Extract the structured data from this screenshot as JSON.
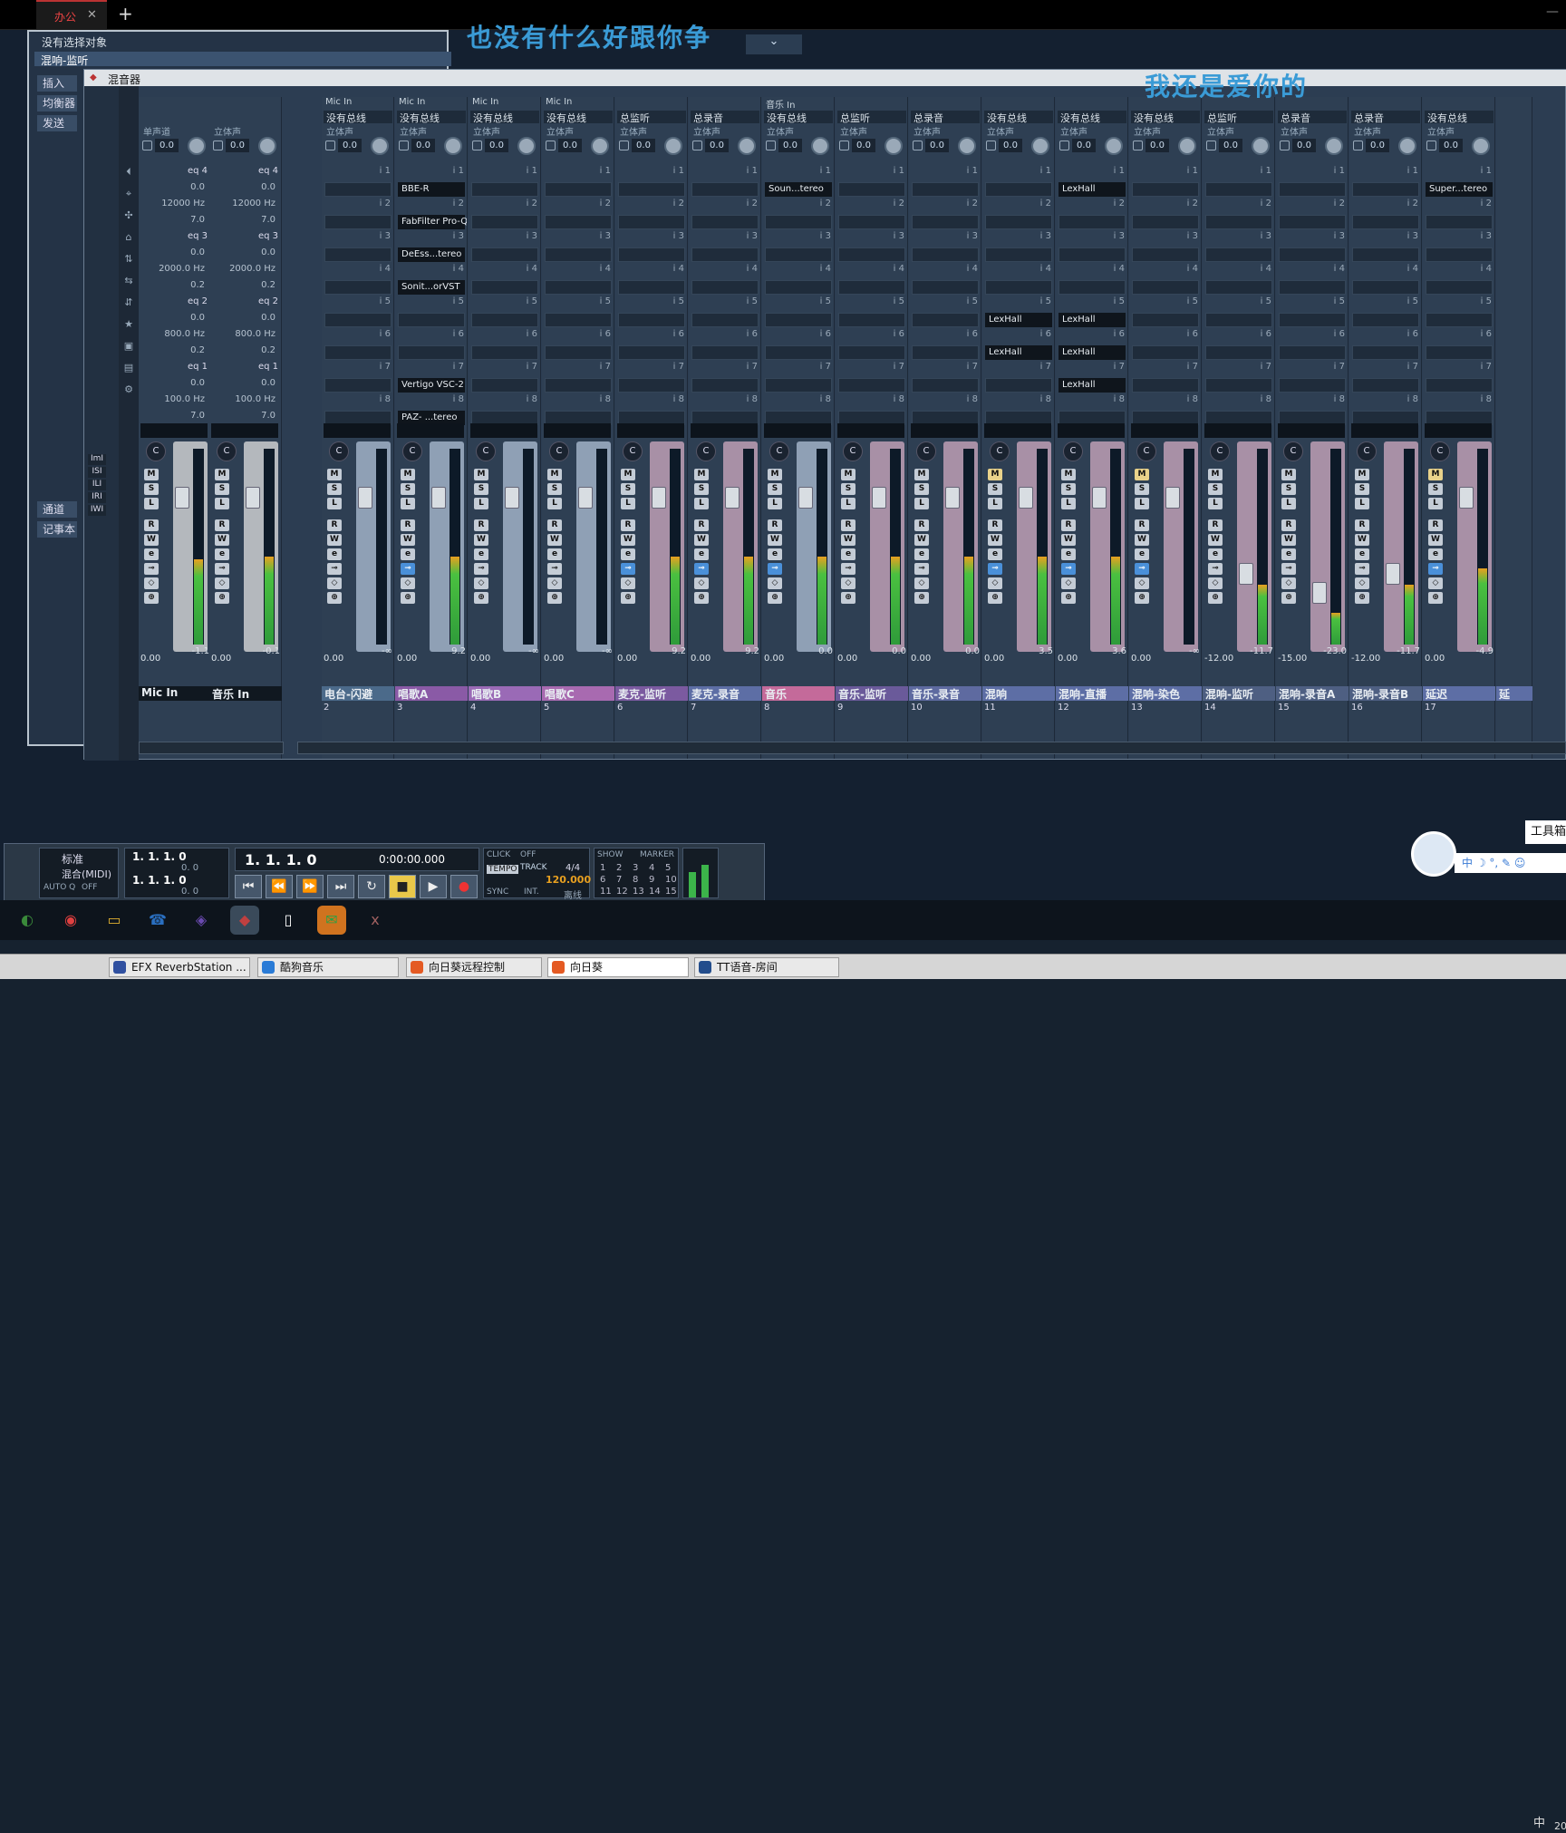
{
  "browser_tab": {
    "label": "办公",
    "close": "✕",
    "new": "+",
    "minimize": "—"
  },
  "inspector": {
    "no_selection": "没有选择对象",
    "channel": "混响-监听",
    "side_tabs": [
      "插入",
      "均衡器",
      "发送"
    ],
    "side_tabs_lower": [
      "通道",
      "记事本"
    ]
  },
  "lyrics": {
    "line1": "也没有什么好跟你争",
    "line2": "我还是爱你的",
    "dropdown": "⌄"
  },
  "mixer": {
    "title": "混音器",
    "left_input_strips": [
      {
        "name": "Mic In",
        "type": "单声道",
        "gain": "0.0",
        "vol": "0.00",
        "peak": "-1.1"
      },
      {
        "name": "音乐 In",
        "type": "立体声",
        "gain": "0.0",
        "vol": "0.00",
        "peak": "-0.1"
      }
    ],
    "eq_labels": [
      "eq 4",
      "eq 3",
      "eq 2",
      "eq 1"
    ],
    "eq_values": {
      "eq4": [
        "0.0",
        "12000 Hz",
        "7.0"
      ],
      "eq3": [
        "0.0",
        "2000.0 Hz",
        "0.2"
      ],
      "eq2": [
        "0.0",
        "800.0 Hz",
        "0.2"
      ],
      "eq1": [
        "0.0",
        "100.0 Hz",
        "7.0"
      ]
    },
    "channels": [
      {
        "num": "2",
        "name": "电台-闪避",
        "input": "Mic In",
        "output": "没有总线",
        "type": "立体声",
        "gain": "0.0",
        "vol": "0.00",
        "peak": "-∞",
        "color": "#4b6a8a",
        "plugins": []
      },
      {
        "num": "3",
        "name": "唱歌A",
        "input": "Mic In",
        "output": "没有总线",
        "type": "立体声",
        "gain": "0.0",
        "vol": "0.00",
        "peak": "9.2",
        "color": "#8a5aa6",
        "plugins": [
          {
            "slot": 0,
            "name": "BBE-R"
          },
          {
            "slot": 1,
            "name": "FabFilter Pro-Q"
          },
          {
            "slot": 2,
            "name": "DeEss...tereo"
          },
          {
            "slot": 3,
            "name": "Sonit...orVST"
          },
          {
            "slot": 6,
            "name": "Vertigo VSC-2"
          },
          {
            "slot": 7,
            "name": "PAZ- ...tereo"
          }
        ]
      },
      {
        "num": "4",
        "name": "唱歌B",
        "input": "Mic In",
        "output": "没有总线",
        "type": "立体声",
        "gain": "0.0",
        "vol": "0.00",
        "peak": "-∞",
        "color": "#9a6ab6",
        "plugins": []
      },
      {
        "num": "5",
        "name": "唱歌C",
        "input": "Mic In",
        "output": "没有总线",
        "type": "立体声",
        "gain": "0.0",
        "vol": "0.00",
        "peak": "-∞",
        "color": "#a86ab0",
        "plugins": []
      },
      {
        "num": "6",
        "name": "麦克-监听",
        "input": "",
        "output": "总监听",
        "type": "立体声",
        "gain": "0.0",
        "vol": "0.00",
        "peak": "9.2",
        "color": "#7b5aa0",
        "plugins": []
      },
      {
        "num": "7",
        "name": "麦克-录音",
        "input": "",
        "output": "总录音",
        "type": "立体声",
        "gain": "0.0",
        "vol": "0.00",
        "peak": "9.2",
        "color": "#5d6ea5",
        "plugins": []
      },
      {
        "num": "8",
        "name": "音乐",
        "input": "音乐 In",
        "output": "没有总线",
        "type": "立体声",
        "gain": "0.0",
        "vol": "0.00",
        "peak": "0.0",
        "color": "#c46a9a",
        "plugins": [
          {
            "slot": 0,
            "name": "Soun...tereo"
          }
        ]
      },
      {
        "num": "9",
        "name": "音乐-监听",
        "input": "",
        "output": "总监听",
        "type": "立体声",
        "gain": "0.0",
        "vol": "0.00",
        "peak": "0.0",
        "color": "#6a5a9a",
        "plugins": []
      },
      {
        "num": "10",
        "name": "音乐-录音",
        "input": "",
        "output": "总录音",
        "type": "立体声",
        "gain": "0.0",
        "vol": "0.00",
        "peak": "0.0",
        "color": "#5e6aa0",
        "plugins": []
      },
      {
        "num": "11",
        "name": "混响",
        "input": "",
        "output": "没有总线",
        "type": "立体声",
        "gain": "0.0",
        "vol": "0.00",
        "peak": "3.5",
        "color": "#5d6ea5",
        "plugins": [
          {
            "slot": 4,
            "name": "LexHall"
          },
          {
            "slot": 5,
            "name": "LexHall"
          }
        ]
      },
      {
        "num": "12",
        "name": "混响-直播",
        "input": "",
        "output": "没有总线",
        "type": "立体声",
        "gain": "0.0",
        "vol": "0.00",
        "peak": "3.6",
        "color": "#5d6ea5",
        "plugins": [
          {
            "slot": 0,
            "name": "LexHall"
          },
          {
            "slot": 4,
            "name": "LexHall"
          },
          {
            "slot": 5,
            "name": "LexHall"
          },
          {
            "slot": 6,
            "name": "LexHall"
          }
        ]
      },
      {
        "num": "13",
        "name": "混响-染色",
        "input": "",
        "output": "没有总线",
        "type": "立体声",
        "gain": "0.0",
        "vol": "0.00",
        "peak": "-∞",
        "color": "#5d6ea5",
        "plugins": []
      },
      {
        "num": "14",
        "name": "混响-监听",
        "input": "",
        "output": "总监听",
        "type": "立体声",
        "gain": "0.0",
        "vol": "-12.00",
        "peak": "-11.7",
        "color": "#4e5f82",
        "plugins": []
      },
      {
        "num": "15",
        "name": "混响-录音A",
        "input": "",
        "output": "总录音",
        "type": "立体声",
        "gain": "0.0",
        "vol": "-15.00",
        "peak": "-23.0",
        "color": "#4e5f82",
        "plugins": []
      },
      {
        "num": "16",
        "name": "混响-录音B",
        "input": "",
        "output": "总录音",
        "type": "立体声",
        "gain": "0.0",
        "vol": "-12.00",
        "peak": "-11.7",
        "color": "#4e5f82",
        "plugins": []
      },
      {
        "num": "17",
        "name": "延迟",
        "input": "",
        "output": "没有总线",
        "type": "立体声",
        "gain": "0.0",
        "vol": "0.00",
        "peak": "-4.9",
        "color": "#5d6ea5",
        "plugins": [
          {
            "slot": 0,
            "name": "Super...tereo"
          }
        ]
      }
    ],
    "partial_channel": {
      "num": "18",
      "name": "延"
    },
    "slot_labels": [
      "i 1",
      "i 2",
      "i 3",
      "i 4",
      "i 5",
      "i 6",
      "i 7",
      "i 8"
    ],
    "fader_buttons": [
      "M",
      "S",
      "L",
      "R",
      "W"
    ],
    "pan_label": "C",
    "no_panner": "no panner",
    "left_tabs": [
      "ImI",
      "ISI",
      "ILI",
      "IRI",
      "IWI"
    ]
  },
  "transport": {
    "preset": "标准",
    "mix_mode": "混合(MIDI)",
    "autoq": "AUTO Q",
    "autoq_state": "OFF",
    "left_locator": "1. 1. 1.   0",
    "left_locator2": "0.   0",
    "right_locator": "1. 1. 1.   0",
    "right_locator2": "0.   0",
    "position_bars": "1. 1. 1.   0",
    "position_time": "0:00:00.000",
    "click": "CLICK",
    "click_state": "OFF",
    "tempo": "TEMPO",
    "track": "TRACK",
    "sig": "4/4",
    "bpm": "120.000",
    "sync": "SYNC",
    "int": "INT.",
    "offline": "离线",
    "show": "SHOW",
    "marker": "MARKER",
    "markers": [
      "1",
      "2",
      "3",
      "4",
      "5",
      "6",
      "7",
      "8",
      "9",
      "10",
      "11",
      "12",
      "13",
      "14",
      "15"
    ],
    "buttons": [
      "⏮",
      "⏪",
      "⏩",
      "⏭",
      "↻",
      "■",
      "▶",
      "●"
    ]
  },
  "taskbar": {
    "icons": [
      "windows-start",
      "chrome",
      "explorer",
      "tt-voice",
      "cubase-stack",
      "cubase",
      "notepad",
      "wechat",
      "xiangrikui-tray"
    ],
    "tray_lang": "中",
    "tray_year": "20",
    "tooltip": "工具箱",
    "ime": "中 ☽ °, ✎ ☺"
  },
  "bottom_tasks": [
    {
      "label": "EFX ReverbStation ...",
      "color": "#3050a0"
    },
    {
      "label": "酷狗音乐",
      "color": "#2a7bd6"
    },
    {
      "label": "向日葵远程控制",
      "color": "#e45a23"
    },
    {
      "label": "向日葵",
      "color": "#e45a23",
      "active": true
    },
    {
      "label": "TT语音-房间",
      "color": "#234d8c"
    }
  ]
}
